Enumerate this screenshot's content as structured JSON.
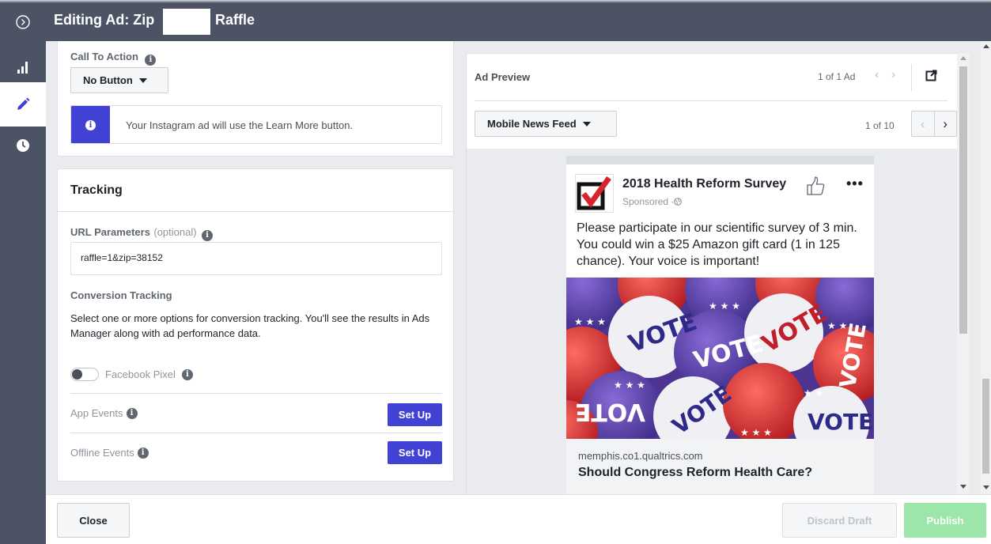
{
  "header": {
    "title_prefix": "Editing Ad: Zip",
    "title_suffix": "Raffle"
  },
  "rail": {
    "expand_icon": "circle-chevron-right-icon",
    "items": [
      {
        "icon": "bar-chart-icon"
      },
      {
        "icon": "pencil-icon"
      },
      {
        "icon": "clock-icon"
      }
    ]
  },
  "cta": {
    "label": "Call To Action",
    "button": "No Button",
    "notice": "Your Instagram ad will use the Learn More button."
  },
  "tracking": {
    "title": "Tracking",
    "url_label": "URL Parameters",
    "url_optional": "(optional)",
    "url_value": "raffle=1&zip=38152",
    "conversion_title": "Conversion Tracking",
    "conversion_desc": "Select one or more options for conversion tracking. You'll see the results in Ads Manager along with ad performance data.",
    "pixel_label": "Facebook Pixel",
    "app_events": "App Events",
    "offline_events": "Offline Events",
    "setup": "Set Up"
  },
  "preview": {
    "title": "Ad Preview",
    "count": "1 of 1 Ad",
    "placement": "Mobile News Feed",
    "placement_count": "1 of 10",
    "page_name": "2018 Health Reform Survey",
    "sponsored": "Sponsored · ",
    "body": "Please participate in our scientific survey of 3 min. You could win a $25 Amazon gift card (1 in 125 chance). Your voice is important!",
    "button_text": "VOTE",
    "link_domain": "memphis.co1.qualtrics.com",
    "headline": "Should Congress Reform Health Care?"
  },
  "footer": {
    "close": "Close",
    "discard": "Discard Draft",
    "publish": "Publish"
  },
  "colors": {
    "rail": "#4b5364",
    "accent": "#4142d3",
    "publish": "#9be6a8"
  }
}
